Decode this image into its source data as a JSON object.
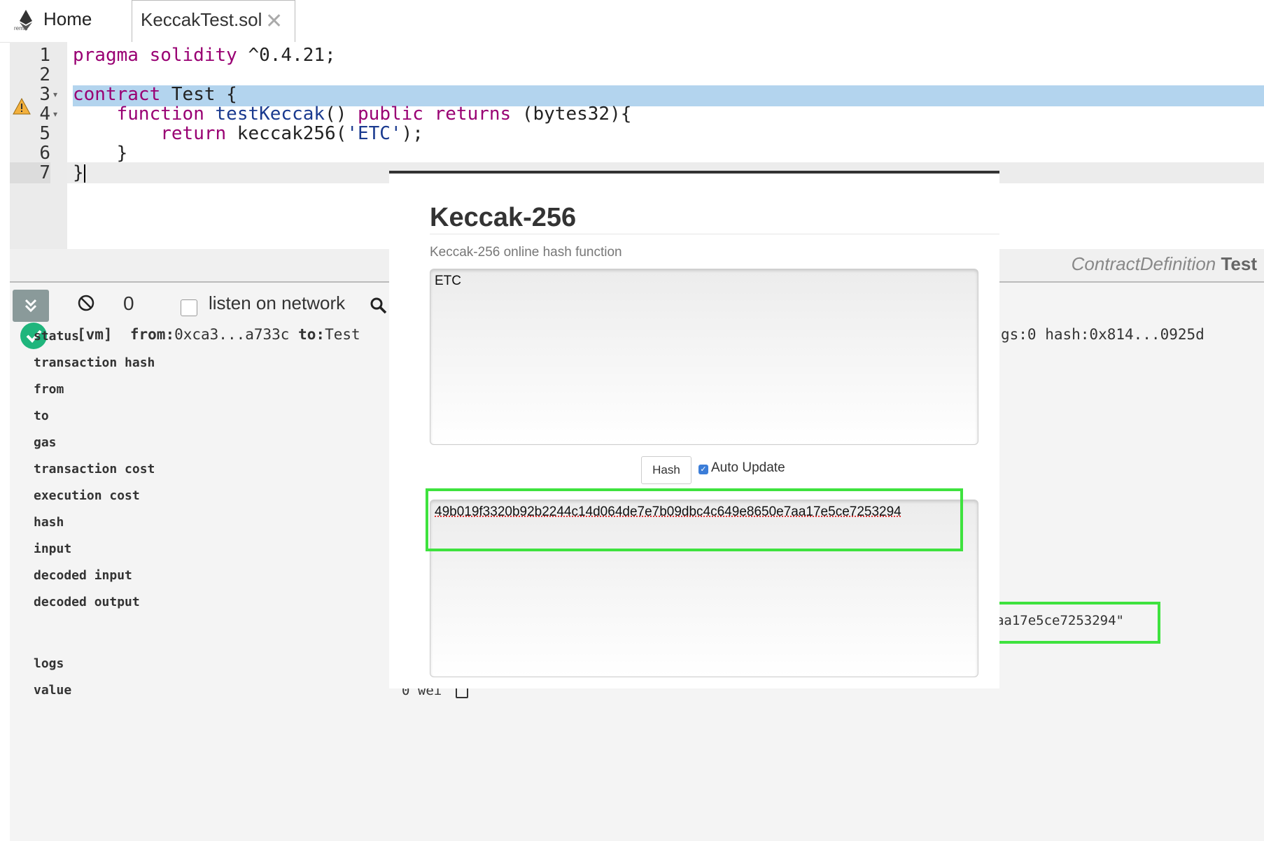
{
  "tabs": {
    "logo_text": "remix",
    "home": "Home",
    "file": "KeccakTest.sol",
    "close": "✕"
  },
  "editor": {
    "line_numbers": [
      "1",
      "2",
      "3",
      "4",
      "5",
      "6",
      "7"
    ],
    "lines": [
      "pragma solidity ^0.4.21;",
      "",
      "contract Test {",
      "    function testKeccak() public returns (bytes32){",
      "        return keccak256('ETC');",
      "    }",
      "}"
    ]
  },
  "statusbar": {
    "label": "ContractDefinition",
    "name": "Test"
  },
  "terminal": {
    "count": "0",
    "listen_label": "listen on network",
    "tx_vm": "[vm]",
    "tx_from_key": "from:",
    "tx_from_val": "0xca3...a733c",
    "tx_to_key": "to:",
    "tx_to_val": "Test",
    "tx_tail": "gs:0 hash:0x814...0925d",
    "fields": [
      "status",
      "transaction hash",
      "from",
      "to",
      "gas",
      "transaction cost",
      "execution cost",
      "hash",
      "input",
      "decoded input",
      "decoded output",
      "logs",
      "value"
    ],
    "decoded_open": "{",
    "decoded_line": "\"0\": \"bytes32: 0x49b019f3320b92b2244c14d064de7e7b09dbc4c649e8650e7aa17e5ce7253294\"",
    "decoded_close": "}",
    "logs_value": "[]",
    "value_value": "0 wei"
  },
  "popup": {
    "title": "Keccak-256",
    "subtitle": "Keccak-256 online hash function",
    "input_text": "ETC",
    "hash_button": "Hash",
    "auto_update_label": "Auto Update",
    "auto_update_checked": true,
    "output_text": "49b019f3320b92b2244c14d064de7e7b09dbc4c649e8650e7aa17e5ce7253294"
  },
  "colors": {
    "highlight_line": "#b3d4ee",
    "keyword": "#990073",
    "success_green": "#1fb57c",
    "annotation_box": "#3ee23e"
  }
}
